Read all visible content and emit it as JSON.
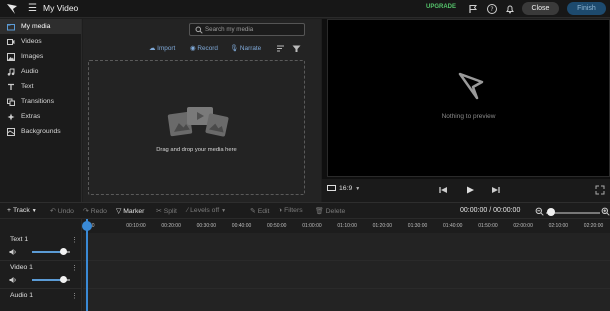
{
  "header": {
    "title": "My Video",
    "upgrade_label": "UPGRADE",
    "close_label": "Close",
    "finish_label": "Finish",
    "icons": [
      "app-logo-icon",
      "menu-icon",
      "flag-icon",
      "help-icon",
      "notification-bell-icon"
    ]
  },
  "sidebar": {
    "items": [
      {
        "label": "My media",
        "icon": "media-folder-icon",
        "active": true
      },
      {
        "label": "Videos",
        "icon": "video-icon"
      },
      {
        "label": "Images",
        "icon": "image-icon"
      },
      {
        "label": "Audio",
        "icon": "music-note-icon"
      },
      {
        "label": "Text",
        "icon": "text-icon"
      },
      {
        "label": "Transitions",
        "icon": "transitions-icon"
      },
      {
        "label": "Extras",
        "icon": "sparkle-icon"
      },
      {
        "label": "Backgrounds",
        "icon": "backgrounds-icon"
      }
    ]
  },
  "media": {
    "search_placeholder": "Search my media",
    "import_label": "Import",
    "record_label": "Record",
    "narrate_label": "Narrate",
    "drop_text": "Drag and drop your media here"
  },
  "preview": {
    "empty_text": "Nothing to preview",
    "aspect_ratio": "16:9"
  },
  "toolbar": {
    "track_label": "Track",
    "undo_label": "Undo",
    "redo_label": "Redo",
    "marker_label": "Marker",
    "split_label": "Split",
    "levels_label": "Levels off",
    "edit_label": "Edit",
    "filters_label": "Filters",
    "delete_label": "Delete",
    "time_display": "00:00:00 / 00:00:00"
  },
  "timeline": {
    "ticks": [
      "00",
      "00:10:00",
      "00:20:00",
      "00:30:00",
      "00:40:00",
      "00:50:00",
      "01:00:00",
      "01:10:00",
      "01:20:00",
      "01:30:00",
      "01:40:00",
      "01:50:00",
      "02:00:00",
      "02:10:00",
      "02:20:00"
    ],
    "tracks": [
      {
        "name": "Text 1"
      },
      {
        "name": "Video 1"
      },
      {
        "name": "Audio 1"
      }
    ]
  },
  "colors": {
    "accent": "#3a8ad6",
    "upgrade": "#55c36b",
    "finish_bg": "#1d4a6e",
    "action_link": "#7fa9d8"
  }
}
